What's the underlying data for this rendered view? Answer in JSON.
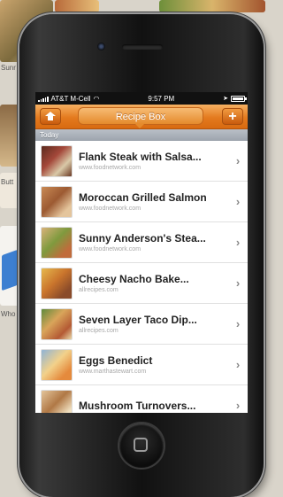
{
  "background": {
    "side_text_1": "Sunr",
    "side_text_2": "Butt",
    "side_text_3": "Who"
  },
  "status_bar": {
    "carrier": "AT&T M-Cell",
    "time": "9:57 PM",
    "battery_level": 0.85
  },
  "nav": {
    "title": "Recipe Box",
    "add_label": "+"
  },
  "section": {
    "header": "Today"
  },
  "recipes": [
    {
      "title": "Flank Steak with Salsa...",
      "source": "www.foodnetwork.com"
    },
    {
      "title": "Moroccan Grilled Salmon",
      "source": "www.foodnetwork.com"
    },
    {
      "title": "Sunny Anderson's Stea...",
      "source": "www.foodnetwork.com"
    },
    {
      "title": "Cheesy Nacho Bake...",
      "source": "allrecipes.com"
    },
    {
      "title": "Seven Layer Taco Dip...",
      "source": "allrecipes.com"
    },
    {
      "title": "Eggs Benedict",
      "source": "www.marthastewart.com"
    },
    {
      "title": "Mushroom Turnovers...",
      "source": ""
    }
  ],
  "icons": {
    "home": "home-icon",
    "chevron": "chevron-right-icon",
    "wifi": "wifi-icon",
    "location": "location-arrow-icon"
  },
  "colors": {
    "nav_orange": "#e47a1e",
    "section_gray": "#a3aab3"
  }
}
